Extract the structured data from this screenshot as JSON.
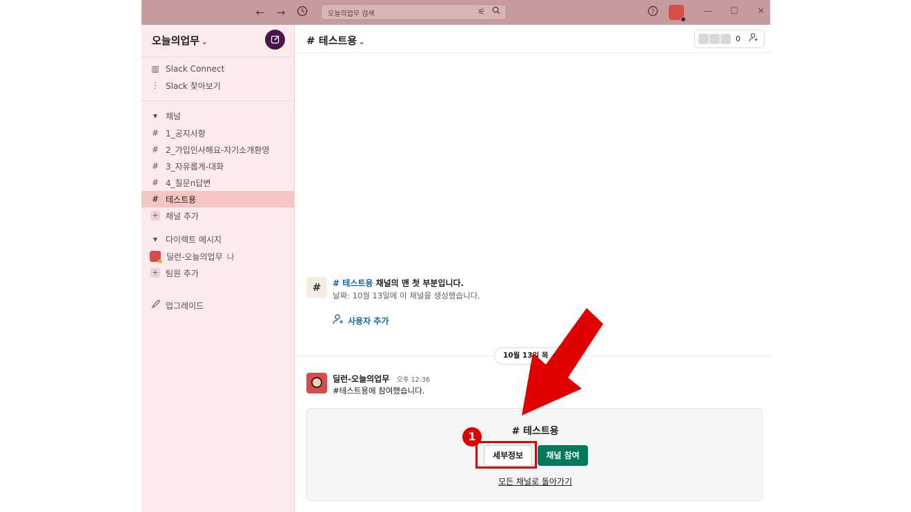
{
  "titlebar": {
    "search_placeholder": "오늘의업무 검색",
    "icons": [
      "back-arrow-icon",
      "forward-arrow-icon",
      "history-icon",
      "filter-icon",
      "search-icon",
      "help-icon"
    ]
  },
  "sidebar": {
    "workspace_name": "오늘의업무",
    "top_items": [
      {
        "label": "Slack Connect",
        "icon": "building-icon"
      },
      {
        "label": "Slack 찾아보기",
        "icon": "more-vertical-icon"
      }
    ],
    "channels_header": "채널",
    "channels": [
      "1_공지사항",
      "2_가입인사해요-자기소개환영",
      "3_자유롭게-대화",
      "4_질문n답변",
      "테스트용"
    ],
    "active_channel": "테스트용",
    "add_channel": "채널 추가",
    "dm_header": "다이렉트 메시지",
    "dm_user": "딜런-오늘의업무",
    "dm_me": "나",
    "add_member": "팀원 추가",
    "upgrade": "업그레이드"
  },
  "main": {
    "channel_title": "# 테스트용",
    "member_count": "0",
    "intro": {
      "channel_link": "# 테스트용",
      "text": " 채널의 맨 첫 부분입니다.",
      "created": "날짜: 10월 13일에 이 채널을 생성했습니다.",
      "add_user": "사용자 추가"
    },
    "date_divider": "10월 13일 목",
    "message": {
      "author": "딜런-오늘의업무",
      "time": "오후 12:36",
      "text": "#테스트용에 참여했습니다."
    },
    "join_card": {
      "title": "# 테스트용",
      "details_button": "세부정보",
      "join_button": "채널 참여",
      "back_link": "모든 채널로 돌아가기"
    }
  },
  "annotation": {
    "step_number": "1",
    "color": "#e00000"
  }
}
